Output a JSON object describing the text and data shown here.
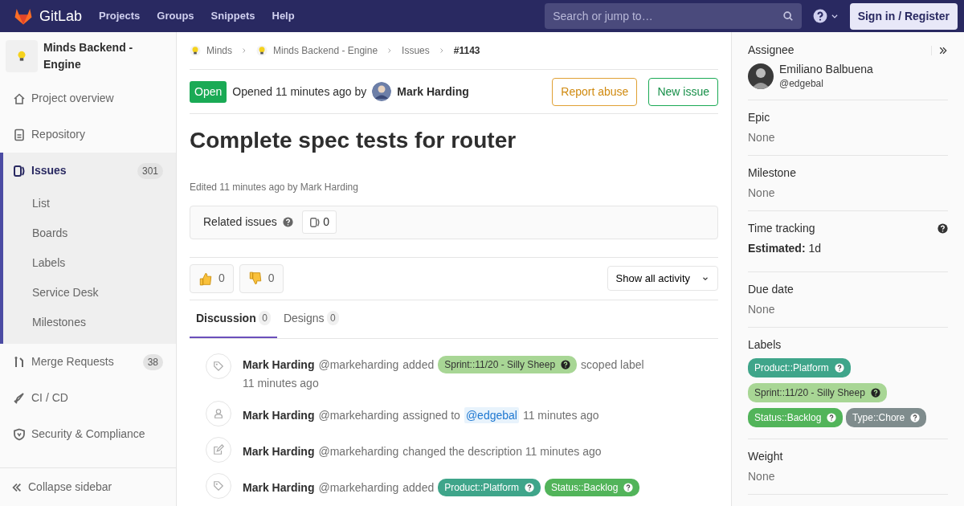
{
  "navbar": {
    "brand": "GitLab",
    "links": [
      "Projects",
      "Groups",
      "Snippets",
      "Help"
    ],
    "search": {
      "placeholder": "Search or jump to…"
    },
    "sign_in": "Sign in / Register"
  },
  "sidebar": {
    "project": "Minds Backend - Engine",
    "items": [
      {
        "label": "Project overview",
        "selected": false
      },
      {
        "label": "Repository",
        "selected": false
      },
      {
        "label": "Issues",
        "count": "301",
        "selected": true,
        "expanded": true,
        "children": [
          {
            "label": "List",
            "selected": false
          },
          {
            "label": "Boards",
            "selected": false
          },
          {
            "label": "Labels",
            "selected": false
          },
          {
            "label": "Service Desk",
            "selected": false
          },
          {
            "label": "Milestones",
            "selected": false
          }
        ]
      },
      {
        "label": "Merge Requests",
        "count": "38",
        "selected": false
      },
      {
        "label": "CI / CD",
        "selected": false
      },
      {
        "label": "Security & Compliance",
        "selected": false
      }
    ],
    "collapse": "Collapse sidebar"
  },
  "breadcrumbs": [
    "Minds",
    "Minds Backend - Engine",
    "Issues",
    "#1143"
  ],
  "issue": {
    "status": "Open",
    "opened": "Opened 11 minutes ago by",
    "author": "Mark Harding",
    "buttons": [
      "Report abuse",
      "New issue"
    ],
    "title": "Complete spec tests for router",
    "edited": "Edited 11 minutes ago by Mark Harding",
    "related": {
      "label": "Related issues",
      "count": "0"
    },
    "awards": [
      {
        "kind": "up",
        "count": "0"
      },
      {
        "kind": "down",
        "count": "0"
      }
    ],
    "filter": "Show all activity",
    "tabs": [
      {
        "label": "Discussion",
        "count": "0",
        "selected": true
      },
      {
        "label": "Designs",
        "count": "0",
        "selected": false
      }
    ],
    "notes": [
      {
        "kind": "label",
        "author": "Mark Harding",
        "handle": "@markeharding",
        "parts": [
          {
            "kind": "text",
            "text": "added"
          },
          {
            "kind": "label",
            "text": "Sprint::11/20 - Silly Sheep",
            "color": "#a8d695"
          },
          {
            "kind": "text",
            "text": "scoped label"
          }
        ],
        "time": "11 minutes ago"
      },
      {
        "kind": "user",
        "author": "Mark Harding",
        "handle": "@markeharding",
        "parts": [
          {
            "kind": "text",
            "text": "assigned to"
          },
          {
            "kind": "mention",
            "text": "@edgebal"
          },
          {
            "kind": "text",
            "text": "11 minutes ago"
          }
        ]
      },
      {
        "kind": "edit",
        "author": "Mark Harding",
        "handle": "@markeharding",
        "parts": [
          {
            "kind": "text",
            "text": "changed the description 11 minutes ago"
          }
        ]
      },
      {
        "kind": "label",
        "author": "Mark Harding",
        "handle": "@markeharding",
        "parts": [
          {
            "kind": "text",
            "text": "added"
          },
          {
            "kind": "label",
            "text": "Product::Platform",
            "color": "#3fa58a"
          },
          {
            "kind": "label",
            "text": "Status::Backlog",
            "color": "#52b45a"
          }
        ]
      }
    ]
  },
  "right_sidebar": {
    "sections": [
      {
        "kind": "assignee",
        "title": "Assignee",
        "name": "Emiliano Balbuena",
        "username": "@edgebal"
      },
      {
        "kind": "value",
        "title": "Epic",
        "value": "None"
      },
      {
        "kind": "value",
        "title": "Milestone",
        "value": "None"
      },
      {
        "kind": "time",
        "title": "Time tracking",
        "estimate_label": "Estimated:",
        "estimate": "1d"
      },
      {
        "kind": "value",
        "title": "Due date",
        "value": "None"
      },
      {
        "kind": "labels",
        "title": "Labels",
        "labels": [
          {
            "text": "Product::Platform",
            "color": "#3fa58a"
          },
          {
            "text": "Sprint::11/20 - Silly Sheep",
            "color": "#a8d695"
          },
          {
            "text": "Status::Backlog",
            "color": "#52b45a"
          },
          {
            "text": "Type::Chore",
            "color": "#7f8c8d"
          }
        ]
      },
      {
        "kind": "value",
        "title": "Weight",
        "value": "None"
      }
    ]
  }
}
